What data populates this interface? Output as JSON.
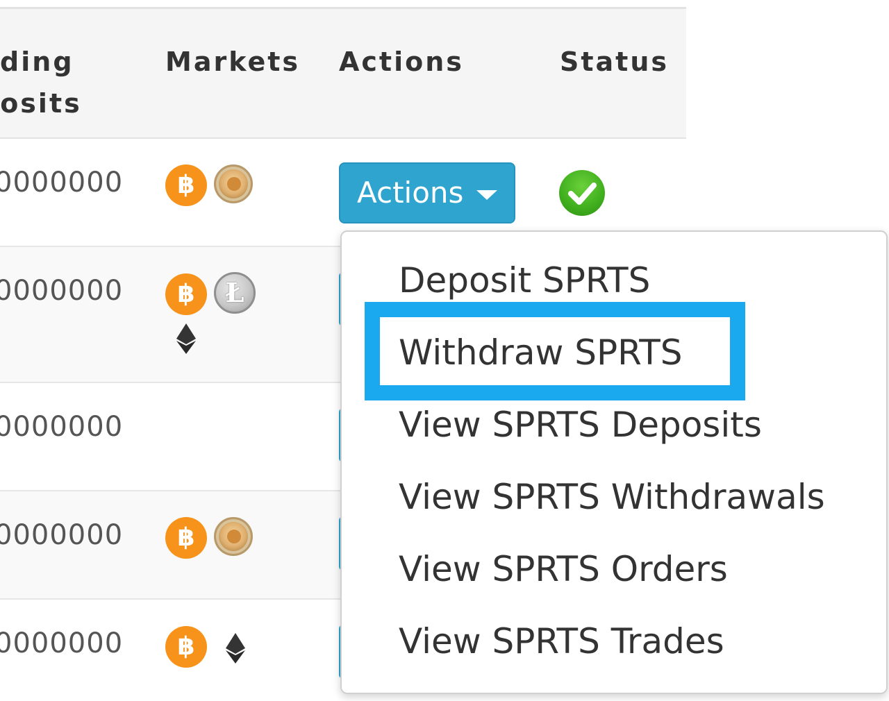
{
  "table": {
    "headers": {
      "pending_deposits": [
        "nding",
        "posits"
      ],
      "markets": "Markets",
      "actions": "Actions",
      "status": "Status"
    },
    "rows": [
      {
        "amount": "0000000",
        "markets": [
          "bitcoin-icon",
          "dogecoin-icon"
        ]
      },
      {
        "amount": "0000000",
        "markets": [
          "bitcoin-icon",
          "litecoin-icon",
          "ethereum-icon"
        ]
      },
      {
        "amount": "0000000",
        "markets": []
      },
      {
        "amount": "0000000",
        "markets": [
          "bitcoin-icon",
          "dogecoin-icon"
        ]
      },
      {
        "amount": "0000000",
        "markets": [
          "bitcoin-icon",
          "ethereum-icon"
        ]
      }
    ],
    "btc_symbol": "฿",
    "ltc_symbol": "Ł"
  },
  "actions_button": {
    "label": "Actions",
    "icon": "caret-down-icon"
  },
  "status": {
    "icon": "check-circle-icon",
    "color": "#3fae1d"
  },
  "dropdown": {
    "items": [
      "Deposit SPRTS",
      "Withdraw SPRTS",
      "View SPRTS Deposits",
      "View SPRTS Withdrawals",
      "View SPRTS Orders",
      "View SPRTS Trades"
    ],
    "highlighted_index": 1,
    "highlight_color": "#1aa9ef"
  },
  "colors": {
    "button": "#2fa4cf",
    "bitcoin": "#f7931a",
    "header_bg": "#f5f5f5"
  }
}
